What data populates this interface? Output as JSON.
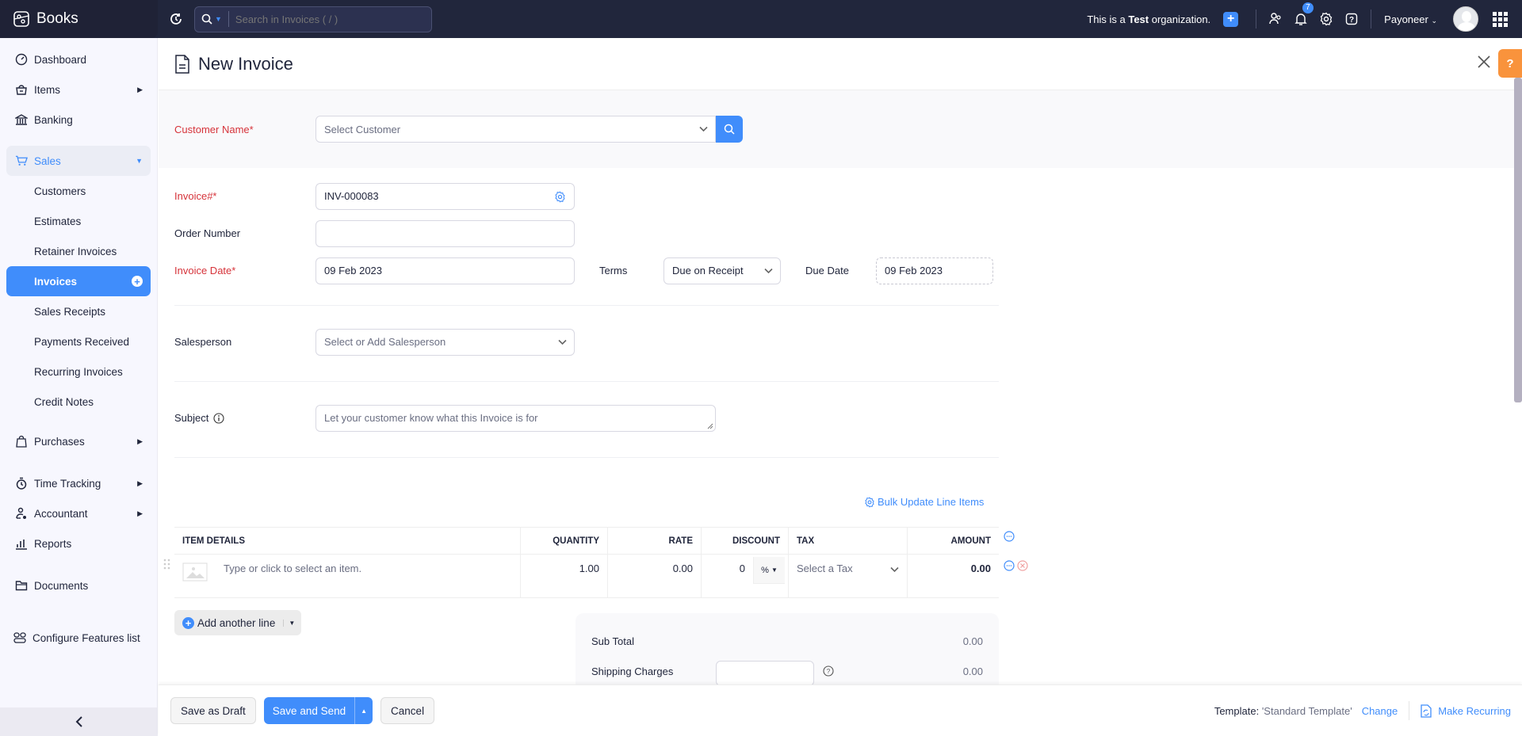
{
  "topbar": {
    "brand": "Books",
    "search_placeholder": "Search in Invoices ( / )",
    "org_prefix": "This is a ",
    "org_bold": "Test",
    "org_suffix": " organization.",
    "notification_count": "7",
    "org_name": "Payoneer"
  },
  "sidebar": {
    "items": [
      {
        "label": "Dashboard",
        "icon": "dashboard-icon"
      },
      {
        "label": "Items",
        "icon": "basket-icon",
        "arrow": true
      },
      {
        "label": "Banking",
        "icon": "bank-icon"
      },
      {
        "label": "Sales",
        "icon": "cart-icon",
        "expanded": true
      },
      {
        "label": "Purchases",
        "icon": "bag-icon",
        "arrow": true
      },
      {
        "label": "Time Tracking",
        "icon": "stopwatch-icon",
        "arrow": true
      },
      {
        "label": "Accountant",
        "icon": "accountant-icon",
        "arrow": true
      },
      {
        "label": "Reports",
        "icon": "reports-icon"
      },
      {
        "label": "Documents",
        "icon": "folder-icon"
      },
      {
        "label": "Configure Features list",
        "icon": "configure-icon"
      }
    ],
    "sales_sub": [
      "Customers",
      "Estimates",
      "Retainer Invoices",
      "Invoices",
      "Sales Receipts",
      "Payments Received",
      "Recurring Invoices",
      "Credit Notes"
    ],
    "active_sub": "Invoices"
  },
  "page": {
    "title": "New Invoice"
  },
  "form": {
    "customer_label": "Customer Name*",
    "customer_placeholder": "Select Customer",
    "invoice_no_label": "Invoice#*",
    "invoice_no_value": "INV-000083",
    "order_label": "Order Number",
    "order_value": "",
    "invoice_date_label": "Invoice Date*",
    "invoice_date_value": "09 Feb 2023",
    "terms_label": "Terms",
    "terms_value": "Due on Receipt",
    "due_date_label": "Due Date",
    "due_date_value": "09 Feb 2023",
    "salesperson_label": "Salesperson",
    "salesperson_placeholder": "Select or Add Salesperson",
    "subject_label": "Subject",
    "subject_placeholder": "Let your customer know what this Invoice is for"
  },
  "items": {
    "bulk_update": "Bulk Update Line Items",
    "columns": [
      "ITEM DETAILS",
      "QUANTITY",
      "RATE",
      "DISCOUNT",
      "TAX",
      "AMOUNT"
    ],
    "rows": [
      {
        "item_placeholder": "Type or click to select an item.",
        "quantity": "1.00",
        "rate": "0.00",
        "discount": "0",
        "discount_unit": "%",
        "tax_placeholder": "Select a Tax",
        "amount": "0.00"
      }
    ],
    "add_line": "Add another line"
  },
  "totals": {
    "sub_total_label": "Sub Total",
    "sub_total_value": "0.00",
    "shipping_label": "Shipping Charges",
    "shipping_value": "0.00",
    "shipping_input": ""
  },
  "footer": {
    "save_draft": "Save as Draft",
    "save_send": "Save and Send",
    "cancel": "Cancel",
    "template_label": "Template:",
    "template_value": "'Standard Template'",
    "change": "Change",
    "make_recurring": "Make Recurring"
  },
  "colors": {
    "accent": "#408dfb",
    "required": "#d6333a",
    "topbar": "#21263c",
    "help": "#f9933c"
  }
}
